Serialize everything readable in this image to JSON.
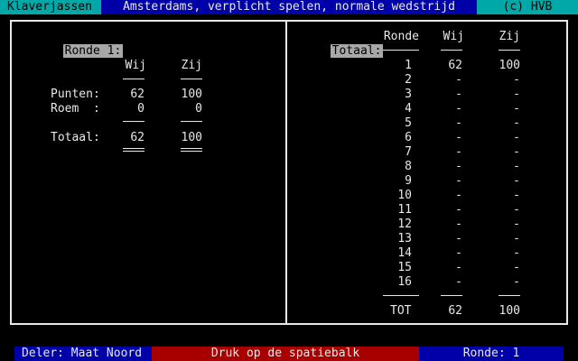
{
  "title_bar": {
    "app": "Klaverjassen",
    "mode": "Amsterdams, verplicht spelen, normale wedstrijd",
    "copyright": "(c) HVB",
    "colors": {
      "app_bg": "#00a8a8",
      "mode_bg": "#0000a8",
      "copy_bg": "#00a8a8"
    }
  },
  "left": {
    "round_label": "Ronde 1:",
    "col_wij": "Wij",
    "col_zij": "Zij",
    "rows": [
      {
        "label": "Punten:",
        "wij": "62",
        "zij": "100"
      },
      {
        "label": "Roem  :",
        "wij": "0",
        "zij": "0"
      }
    ],
    "total": {
      "label": "Totaal:",
      "wij": "62",
      "zij": "100"
    }
  },
  "right": {
    "total_label": "Totaal:",
    "col_ronde": "Ronde",
    "col_wij": "Wij",
    "col_zij": "Zij",
    "rows": [
      {
        "ronde": "1",
        "wij": "62",
        "zij": "100"
      },
      {
        "ronde": "2",
        "wij": "-",
        "zij": "-"
      },
      {
        "ronde": "3",
        "wij": "-",
        "zij": "-"
      },
      {
        "ronde": "4",
        "wij": "-",
        "zij": "-"
      },
      {
        "ronde": "5",
        "wij": "-",
        "zij": "-"
      },
      {
        "ronde": "6",
        "wij": "-",
        "zij": "-"
      },
      {
        "ronde": "7",
        "wij": "-",
        "zij": "-"
      },
      {
        "ronde": "8",
        "wij": "-",
        "zij": "-"
      },
      {
        "ronde": "9",
        "wij": "-",
        "zij": "-"
      },
      {
        "ronde": "10",
        "wij": "-",
        "zij": "-"
      },
      {
        "ronde": "11",
        "wij": "-",
        "zij": "-"
      },
      {
        "ronde": "12",
        "wij": "-",
        "zij": "-"
      },
      {
        "ronde": "13",
        "wij": "-",
        "zij": "-"
      },
      {
        "ronde": "14",
        "wij": "-",
        "zij": "-"
      },
      {
        "ronde": "15",
        "wij": "-",
        "zij": "-"
      },
      {
        "ronde": "16",
        "wij": "-",
        "zij": "-"
      }
    ],
    "tot": {
      "label": "TOT",
      "wij": "62",
      "zij": "100"
    }
  },
  "status_bar": {
    "dealer": "Deler: Maat Noord",
    "prompt": "Druk op de spatiebalk",
    "round": "Ronde: 1",
    "colors": {
      "dealer_bg": "#0000a8",
      "prompt_bg": "#a80000",
      "round_bg": "#0000a8"
    }
  }
}
